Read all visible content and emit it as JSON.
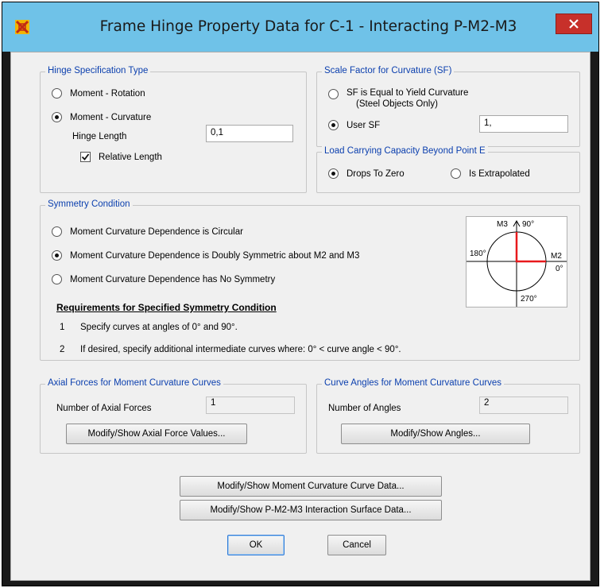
{
  "window": {
    "title": "Frame Hinge Property Data for C-1 - Interacting P-M2-M3",
    "close_glyph": "✕"
  },
  "hinge_spec": {
    "label": "Hinge Specification Type",
    "options": [
      "Moment - Rotation",
      "Moment - Curvature"
    ],
    "selected": "Moment - Curvature",
    "hinge_length_label": "Hinge Length",
    "hinge_length_value": "0,1",
    "relative_length_label": "Relative Length",
    "relative_length_checked": true
  },
  "scale_factor": {
    "label": "Scale Factor for Curvature (SF)",
    "option_yield_line1": "SF is Equal to Yield Curvature",
    "option_yield_line2": "(Steel Objects Only)",
    "option_user": "User SF",
    "selected": "User SF",
    "user_sf_value": "1,"
  },
  "load_capacity": {
    "label": "Load Carrying Capacity Beyond Point E",
    "options": [
      "Drops To Zero",
      "Is Extrapolated"
    ],
    "selected": "Drops To Zero"
  },
  "symmetry": {
    "label": "Symmetry Condition",
    "options": [
      "Moment Curvature Dependence is Circular",
      "Moment Curvature Dependence is Doubly Symmetric about M2 and M3",
      "Moment Curvature Dependence has No Symmetry"
    ],
    "selected": "Moment Curvature Dependence is Doubly Symmetric about M2 and M3",
    "requirements_title": "Requirements for Specified Symmetry Condition",
    "requirements": [
      {
        "num": "1",
        "text": "Specify curves at angles of 0° and 90°."
      },
      {
        "num": "2",
        "text": "If desired, specify additional intermediate curves where:  0° < curve angle < 90°."
      }
    ],
    "diagram": {
      "m3_label": "M3",
      "deg90": "90°",
      "deg180": "180°",
      "m2_label": "M2",
      "deg0": "0°",
      "deg270": "270°",
      "highlight_color": "#e8191c"
    }
  },
  "axial_forces": {
    "label": "Axial Forces for Moment Curvature Curves",
    "count_label": "Number of Axial Forces",
    "count_value": "1",
    "button": "Modify/Show Axial Force Values..."
  },
  "curve_angles": {
    "label": "Curve Angles for Moment Curvature Curves",
    "count_label": "Number of Angles",
    "count_value": "2",
    "button": "Modify/Show Angles..."
  },
  "actions": {
    "curve_data_button": "Modify/Show Moment Curvature Curve Data...",
    "interaction_button": "Modify/Show P-M2-M3 Interaction Surface Data...",
    "ok": "OK",
    "cancel": "Cancel"
  },
  "icons": {
    "app": "sap-app-icon",
    "close": "close-icon"
  }
}
